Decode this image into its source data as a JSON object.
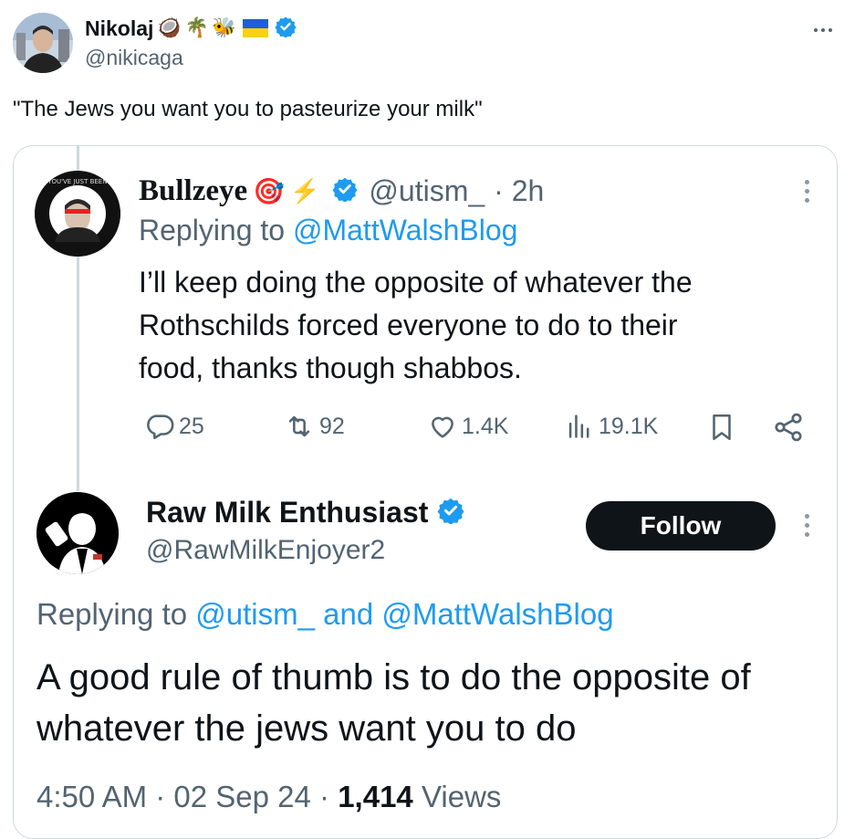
{
  "outer": {
    "name": "Nikolaj",
    "emojis": [
      "🥥",
      "🌴",
      "🐝",
      "🇺🇦"
    ],
    "handle": "@nikicaga",
    "text": "\"The Jews you want you to pasteurize your milk\""
  },
  "reply1": {
    "name": "Bullzeye",
    "emojis": [
      "🎯",
      "⚡"
    ],
    "handle": "@utism_",
    "time": "· 2h",
    "replying_prefix": "Replying to",
    "replying_to": "@MattWalshBlog",
    "text_lines": [
      "I’ll keep doing the opposite of whatever the",
      "Rothschilds forced everyone to do to their",
      "food, thanks though shabbos."
    ],
    "stats": {
      "replies": "25",
      "reposts": "92",
      "likes": "1.4K",
      "views": "19.1K"
    }
  },
  "reply2": {
    "name": "Raw Milk Enthusiast",
    "handle": "@RawMilkEnjoyer2",
    "follow_label": "Follow",
    "replying_prefix": "Replying to",
    "replying_to": "@utism_ and @MattWalshBlog",
    "text_lines": [
      "A good rule of thumb is to do the opposite of",
      "whatever the jews want you to do"
    ],
    "time": "4:50 AM · 02 Sep 24 ·",
    "views_count": "1,414",
    "views_label": "Views"
  },
  "colors": {
    "text": "#0f1419",
    "muted": "#536471",
    "link": "#1d9bf0",
    "verified": "#1d9bf0",
    "border": "#cfd9de",
    "follow_bg": "#0f1419"
  },
  "icons": [
    "verified-badge-icon",
    "reply-icon",
    "repost-icon",
    "like-icon",
    "views-icon",
    "bookmark-icon",
    "share-icon",
    "more-icon"
  ]
}
